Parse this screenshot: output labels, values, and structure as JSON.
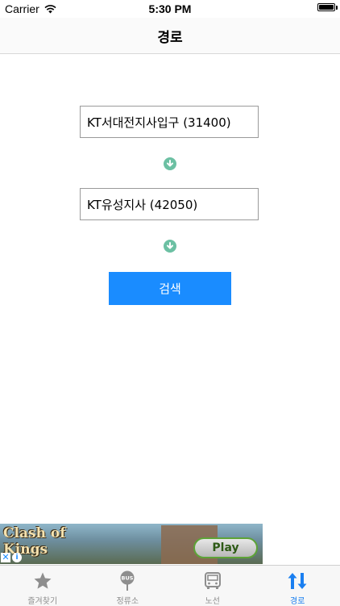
{
  "status_bar": {
    "carrier": "Carrier",
    "time": "5:30 PM",
    "battery_level": 1.0
  },
  "nav": {
    "title": "경로"
  },
  "route": {
    "origin": "KT서대전지사입구 (31400)",
    "destination": "KT유성지사 (42050)",
    "search_label": "검색"
  },
  "ad": {
    "title_line1": "Clash of",
    "title_line2": "Kings",
    "play_label": "Play"
  },
  "tabs": [
    {
      "label": "즐겨찾기",
      "icon": "star-icon",
      "active": false
    },
    {
      "label": "정류소",
      "icon": "bus-stop-icon",
      "active": false
    },
    {
      "label": "노선",
      "icon": "bus-icon",
      "active": false
    },
    {
      "label": "경로",
      "icon": "route-arrows-icon",
      "active": true
    }
  ],
  "colors": {
    "accent": "#1a8cff",
    "arrow": "#6cc0a3",
    "tab_active": "#1a7ff0",
    "tab_inactive": "#8e8e8e"
  }
}
